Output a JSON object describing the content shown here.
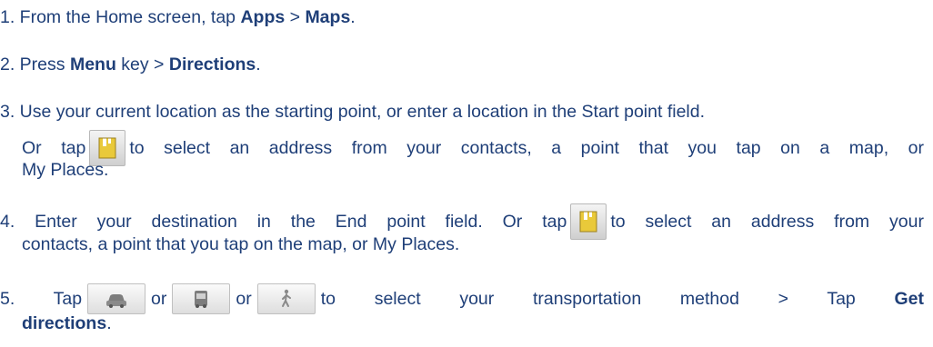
{
  "step1": {
    "prefix": "1. From the Home screen, tap ",
    "apps": "Apps",
    "sep": " > ",
    "maps": "Maps",
    "suffix": "."
  },
  "step2": {
    "prefix": "2. Press ",
    "menu": "Menu",
    "mid": " key > ",
    "directions": "Directions",
    "suffix": "."
  },
  "step3": {
    "line1": "3. Use your current location as the starting point, or enter a location in the Start point field.",
    "line2_before": "Or tap",
    "line2_after": "to select an address from your contacts, a point that you tap on a map, or",
    "line3": "My Places."
  },
  "step4": {
    "line1_before": "4. Enter your destination in the End point field. Or tap",
    "line1_after": "to select an address from your",
    "line2": "contacts, a point that you tap on the map, or My Places."
  },
  "step5": {
    "tap": "5. Tap",
    "or1": "or",
    "or2": "or",
    "after": "to select your transportation method > Tap",
    "get": "Get",
    "directions": "directions",
    "suffix": "."
  },
  "icons": {
    "contact_picker": "contact-picker-icon",
    "car": "car-icon",
    "bus": "bus-icon",
    "walk": "walking-icon"
  },
  "colors": {
    "text": "#1f3f78",
    "icon_yellow": "#e9c93a"
  }
}
